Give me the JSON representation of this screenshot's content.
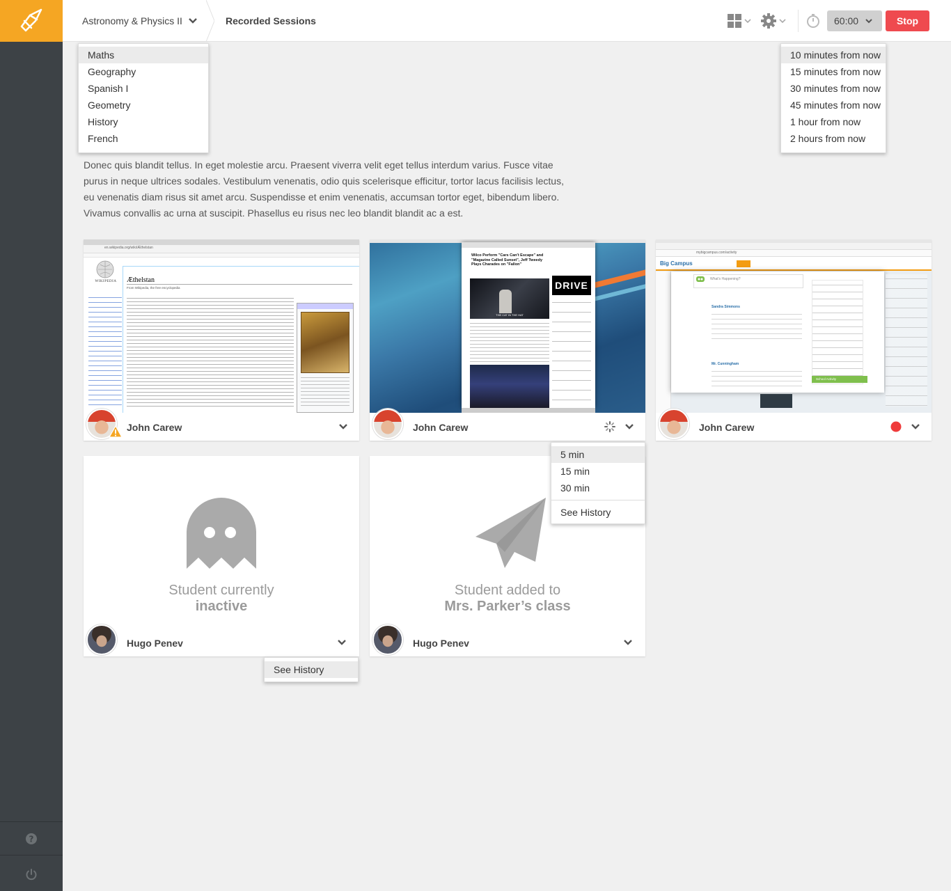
{
  "app": {
    "accent": "#f5a623",
    "stop_color": "#ef4a4f"
  },
  "header": {
    "class_name": "Astronomy & Physics II",
    "page_title": "Recorded Sessions",
    "timer_value": "60:00",
    "stop_label": "Stop"
  },
  "class_menu": {
    "items": [
      "Maths",
      "Geography",
      "Spanish I",
      "Geometry",
      "History",
      "French"
    ],
    "selected": "Maths"
  },
  "timer_menu": {
    "items": [
      "10 minutes from now",
      "15 minutes from now",
      "30 minutes from now",
      "45 minutes from now",
      "1 hour from now",
      "2 hours from now"
    ],
    "selected": "10 minutes from now"
  },
  "description": "Donec quis blandit tellus. In eget molestie arcu. Praesent viverra velit eget tellus interdum varius. Fusce vitae purus in neque ultrices sodales. Vestibulum venenatis, odio quis scelerisque efficitur, tortor lacus facilisis lectus, eu venenatis diam risus sit amet arcu. Suspendisse et enim venenatis, accumsan tortor eget, bibendum libero. Vivamus convallis ac urna at suscipit. Phasellus eu risus nec leo blandit blandit ac a est.",
  "cards": [
    {
      "student": "John Carew",
      "status": "warning",
      "screen": "wikipedia"
    },
    {
      "student": "John Carew",
      "status": "loading",
      "screen": "news"
    },
    {
      "student": "John Carew",
      "status": "recording",
      "screen": "bigcampus"
    },
    {
      "student": "Hugo Penev",
      "status_line1": "Student currently",
      "status_line2": "inactive",
      "icon": "ghost-icon"
    },
    {
      "student": "Hugo Penev",
      "status_line1": "Student added to",
      "status_line2": "Mrs. Parker’s class",
      "icon": "paper-plane-icon"
    }
  ],
  "session_menu": {
    "items": [
      "5 min",
      "15 min",
      "30 min"
    ],
    "selected": "5 min",
    "history_label": "See History"
  },
  "history_menu": {
    "label": "See History"
  },
  "screens": {
    "wiki_url": "en.wikipedia.org/wiki/Æthelstan",
    "wiki_title": "Æthelstan",
    "wiki_from": "From Wikipedia, the free encyclopedia",
    "wiki_logo": "WIKIPEDIA",
    "news_headline": "Wilco Perform \"Cars Can't Escape\" and \"Magazine Called Sunset\", Jeff Tweedy Plays Charades on \"Fallon\"",
    "news_banner": "DRIVE",
    "news_caption": "THE CAT IN THE HAT",
    "campus_logo": "Big Campus",
    "campus_url": "mybigcampus.com/activity",
    "campus_prompt": "What's Happening?",
    "campus_user1": "Sandra Simmons",
    "campus_user2": "Mr. Cunningham",
    "campus_badge": "School Activity"
  }
}
